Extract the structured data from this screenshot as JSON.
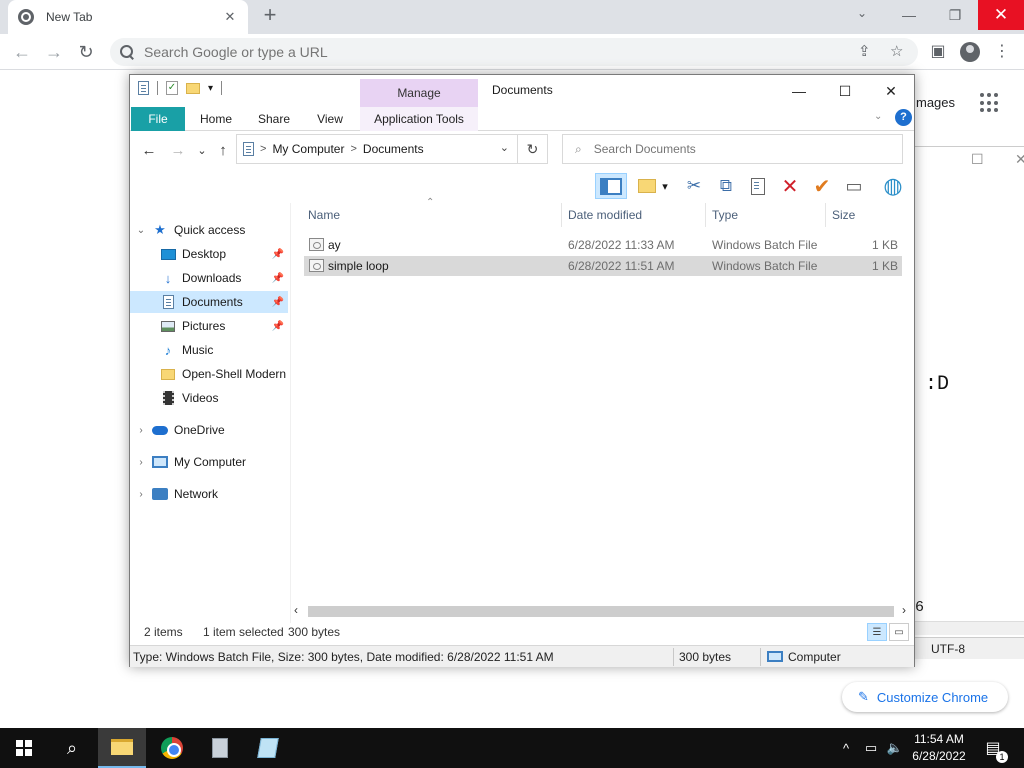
{
  "chrome": {
    "tab_title": "New Tab",
    "tab_close": "✕",
    "new_tab": "+",
    "tab_search": "⌄",
    "window_controls": {
      "minimize": "—",
      "restore": "❐",
      "close": "✕"
    },
    "nav": {
      "back": "←",
      "forward": "→",
      "reload": "↻"
    },
    "omnibox_placeholder": "Search Google or type a URL",
    "toolbar_icons": {
      "share": "⇪",
      "bookmark": "☆",
      "side_panel": "▣",
      "menu": "⋮"
    },
    "ntp_images_link": "mages",
    "customize_label": "Customize Chrome",
    "customize_icon": "✎"
  },
  "background_window": {
    "controls": {
      "restore": "☐",
      "close": "✕"
    },
    "face_text": ":D",
    "partial_char": "6",
    "encoding": "UTF-8"
  },
  "explorer": {
    "title": "Documents",
    "context_tab": "Manage",
    "controls": {
      "minimize": "—",
      "maximize": "☐",
      "close": "✕"
    },
    "ribbon_tabs": [
      "File",
      "Home",
      "Share",
      "View",
      "Application Tools"
    ],
    "ribbon_chevron": "⌄",
    "help": "?",
    "address": {
      "crumbs": [
        "My Computer",
        "Documents"
      ],
      "separator": ">",
      "dropdown": "⌄",
      "refresh": "↻"
    },
    "nav_buttons": {
      "back": "←",
      "forward": "→",
      "recent": "⌄",
      "up": "↑"
    },
    "search_placeholder": "Search Documents",
    "search_icon": "⌕",
    "toolbar_glyphs": {
      "scissors": "✂",
      "copy": "⧉",
      "paste": "📋",
      "delete": "✕",
      "check": "✔",
      "rename": "▭",
      "globe": "◍",
      "dropdown": "▾"
    },
    "nav_pane": {
      "quick_access": "Quick access",
      "items": [
        {
          "label": "Desktop",
          "pinned": true
        },
        {
          "label": "Downloads",
          "pinned": true
        },
        {
          "label": "Documents",
          "pinned": true,
          "selected": true
        },
        {
          "label": "Pictures",
          "pinned": true
        },
        {
          "label": "Music",
          "pinned": false
        },
        {
          "label": "Open-Shell Modern",
          "pinned": false
        },
        {
          "label": "Videos",
          "pinned": false
        }
      ],
      "roots": [
        "OneDrive",
        "My Computer",
        "Network"
      ]
    },
    "columns": {
      "name": "Name",
      "date": "Date modified",
      "type": "Type",
      "size": "Size"
    },
    "files": [
      {
        "name": "ay",
        "date": "6/28/2022 11:33 AM",
        "type": "Windows Batch File",
        "size": "1 KB",
        "selected": false
      },
      {
        "name": "simple loop",
        "date": "6/28/2022 11:51 AM",
        "type": "Windows Batch File",
        "size": "1 KB",
        "selected": true
      }
    ],
    "status": {
      "items": "2 items",
      "selected": "1 item selected",
      "selected_size": "300 bytes",
      "details": "Type: Windows Batch File, Size: 300 bytes, Date modified: 6/28/2022 11:51 AM",
      "size": "300 bytes",
      "location": "Computer"
    }
  },
  "taskbar": {
    "time": "11:54 AM",
    "date": "6/28/2022",
    "notifications": "1",
    "tray_chevron": "^",
    "search_icon": "⌕"
  }
}
